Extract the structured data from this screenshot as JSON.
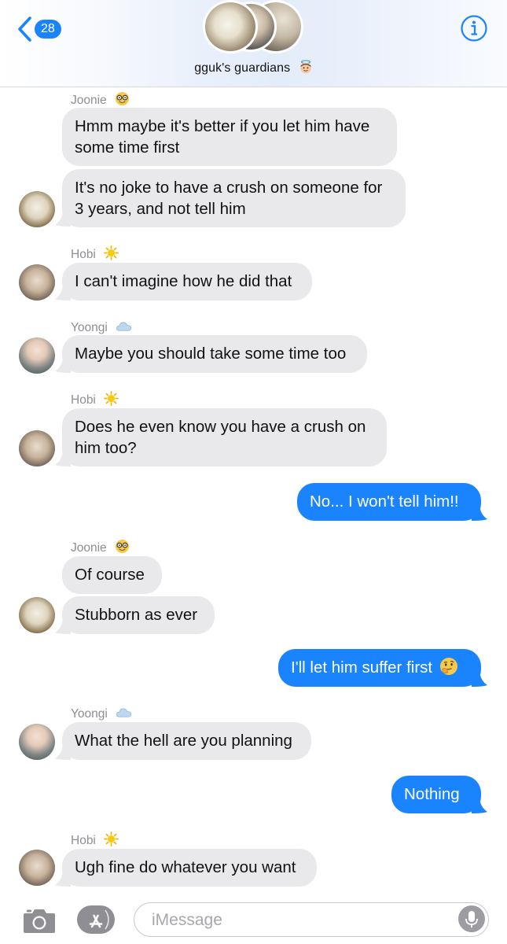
{
  "header": {
    "back_count": "28",
    "group_name": "gguk's guardians",
    "group_emoji": "angel-face"
  },
  "messages": [
    {
      "sender": "Joonie",
      "sender_emoji": "nerd-face",
      "direction": "in",
      "text_lines": [
        "Hmm maybe it's better if you let him have",
        "some time first"
      ]
    },
    {
      "direction": "in",
      "text_lines": [
        "It's no joke to have a crush on someone for",
        "3 years, and not tell him"
      ]
    },
    {
      "sender": "Hobi",
      "sender_emoji": "sun",
      "direction": "in",
      "text_lines": [
        "I can't imagine how he did that"
      ]
    },
    {
      "sender": "Yoongi",
      "sender_emoji": "cloud",
      "direction": "in",
      "text_lines": [
        "Maybe you should take some time too"
      ]
    },
    {
      "sender": "Hobi",
      "sender_emoji": "sun",
      "direction": "in",
      "text_lines": [
        "Does he even know you have a crush on",
        "him too?"
      ]
    },
    {
      "direction": "out",
      "text_lines": [
        "No... I won't tell him!!"
      ]
    },
    {
      "sender": "Joonie",
      "sender_emoji": "nerd-face",
      "direction": "in",
      "text_lines": [
        "Of course"
      ]
    },
    {
      "direction": "in",
      "text_lines": [
        "Stubborn as ever"
      ]
    },
    {
      "direction": "out",
      "text_lines": [
        "I'll let him suffer first"
      ],
      "trailing_emoji": "thinking-face"
    },
    {
      "sender": "Yoongi",
      "sender_emoji": "cloud",
      "direction": "in",
      "text_lines": [
        "What the hell are you planning"
      ]
    },
    {
      "direction": "out",
      "text_lines": [
        "Nothing"
      ]
    },
    {
      "sender": "Hobi",
      "sender_emoji": "sun",
      "direction": "in",
      "text_lines": [
        "Ugh fine do whatever you want"
      ]
    }
  ],
  "input": {
    "placeholder": "iMessage"
  },
  "colors": {
    "outgoing_bubble": "#1a84ff",
    "incoming_bubble": "#e9e9eb",
    "accent": "#1a84ff",
    "sender_label": "#8e8e93"
  }
}
